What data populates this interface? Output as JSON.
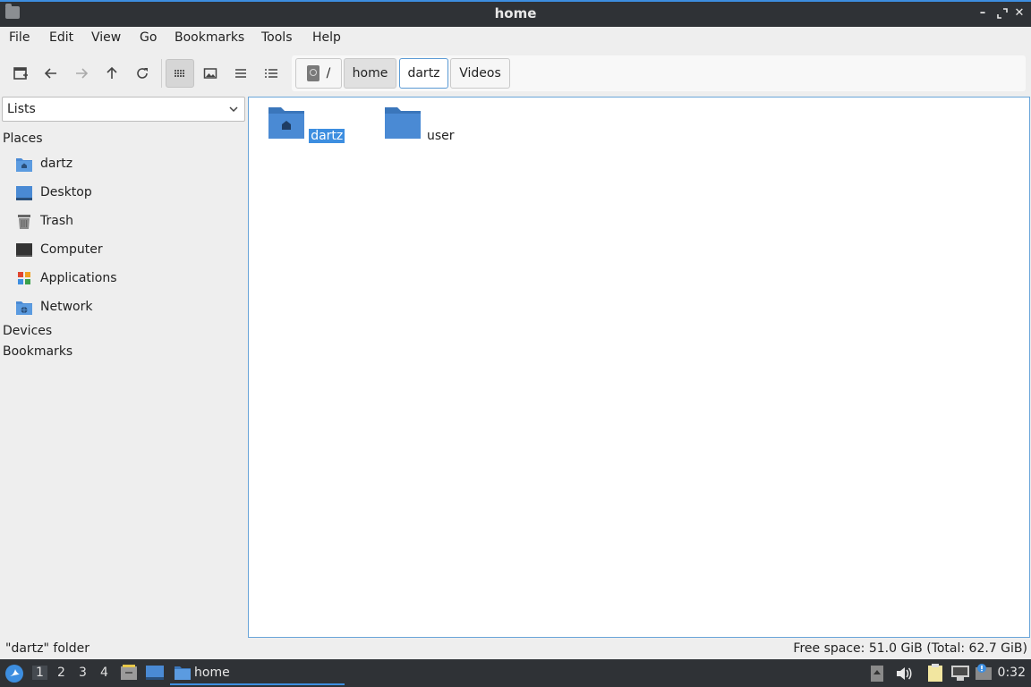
{
  "window": {
    "title": "home"
  },
  "menu": [
    "File",
    "Edit",
    "View",
    "Go",
    "Bookmarks",
    "Tools",
    "Help"
  ],
  "breadcrumb": {
    "root": "/",
    "items": [
      "home",
      "dartz",
      "Videos"
    ]
  },
  "sidebar": {
    "combo_value": "Lists",
    "places_heading": "Places",
    "places": [
      {
        "label": "dartz",
        "icon": "home-folder-icon"
      },
      {
        "label": "Desktop",
        "icon": "desktop-icon"
      },
      {
        "label": "Trash",
        "icon": "trash-icon"
      },
      {
        "label": "Computer",
        "icon": "computer-icon"
      },
      {
        "label": "Applications",
        "icon": "applications-icon"
      },
      {
        "label": "Network",
        "icon": "network-folder-icon"
      }
    ],
    "devices_heading": "Devices",
    "bookmarks_heading": "Bookmarks"
  },
  "files": [
    {
      "name": "dartz",
      "icon": "home-folder-icon",
      "selected": true
    },
    {
      "name": "user",
      "icon": "folder-icon",
      "selected": false
    }
  ],
  "status": {
    "left": "\"dartz\" folder",
    "right": "Free space: 51.0 GiB (Total: 62.7 GiB)"
  },
  "taskbar": {
    "workspaces": [
      "1",
      "2",
      "3",
      "4"
    ],
    "active_workspace": "1",
    "task_label": "home",
    "clock": "0:32"
  },
  "colors": {
    "accent": "#3d8ee0",
    "folder": "#4a8ad4",
    "titlebar": "#2f3236"
  }
}
